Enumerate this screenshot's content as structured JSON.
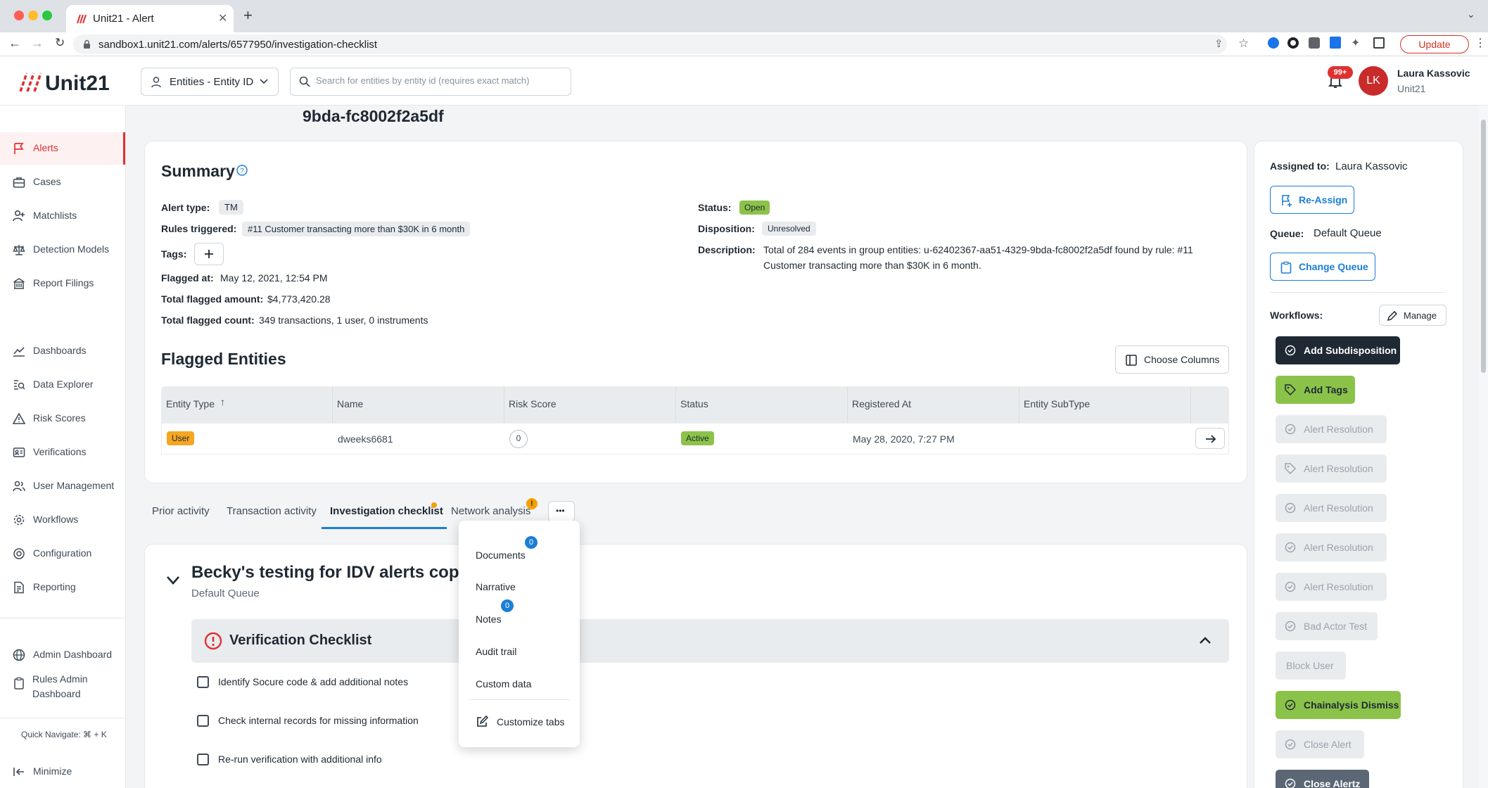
{
  "browser": {
    "tab_title": "Unit21 - Alert",
    "url": "sandbox1.unit21.com/alerts/6577950/investigation-checklist",
    "update_label": "Update"
  },
  "header": {
    "logo_text": "Unit21",
    "entity_select_label": "Entities - Entity ID",
    "search_placeholder": "Search for entities by entity id (requires exact match)",
    "notif_count": "99+",
    "avatar_initials": "LK",
    "user_name": "Laura Kassovic",
    "user_org": "Unit21"
  },
  "sidebar": {
    "items": [
      {
        "label": "Alerts",
        "icon": "flag-icon"
      },
      {
        "label": "Cases",
        "icon": "briefcase-icon"
      },
      {
        "label": "Matchlists",
        "icon": "user-plus-icon"
      },
      {
        "label": "Detection Models",
        "icon": "scale-icon"
      },
      {
        "label": "Report Filings",
        "icon": "building-icon"
      },
      {
        "label": "Dashboards",
        "icon": "chart-line-icon"
      },
      {
        "label": "Data Explorer",
        "icon": "search-data-icon"
      },
      {
        "label": "Risk Scores",
        "icon": "warning-icon"
      },
      {
        "label": "Verifications",
        "icon": "id-card-icon"
      },
      {
        "label": "User Management",
        "icon": "users-icon"
      },
      {
        "label": "Workflows",
        "icon": "gear-icon"
      },
      {
        "label": "Configuration",
        "icon": "settings-icon"
      },
      {
        "label": "Reporting",
        "icon": "report-icon"
      },
      {
        "label": "Admin Dashboard",
        "icon": "globe-icon"
      },
      {
        "label": "Rules Admin",
        "label2": "Dashboard",
        "icon": "clipboard-icon"
      }
    ],
    "quick_navigate": "Quick Navigate: ⌘ + K",
    "minimize": "Minimize"
  },
  "main": {
    "entity_title": "9bda-fc8002f2a5df",
    "summary": {
      "title": "Summary",
      "alert_type_label": "Alert type:",
      "alert_type": "TM",
      "rules_label": "Rules triggered:",
      "rules": "#11 Customer transacting more than $30K in 6 month",
      "tags_label": "Tags:",
      "flagged_at_label": "Flagged at:",
      "flagged_at": "May 12, 2021, 12:54 PM",
      "amount_label": "Total flagged amount:",
      "amount": "$4,773,420.28",
      "count_label": "Total flagged count:",
      "count": "349 transactions, 1 user, 0 instruments",
      "status_label": "Status:",
      "status": "Open",
      "disposition_label": "Disposition:",
      "disposition": "Unresolved",
      "description_label": "Description:",
      "description_line1": "Total of 284 events in group entities: u-62402367-aa51-4329-9bda-fc8002f2a5df found by rule: #11",
      "description_line2": "Customer transacting more than $30K in 6 month."
    },
    "flagged": {
      "title": "Flagged Entities",
      "choose_columns": "Choose Columns",
      "columns": [
        "Entity Type",
        "Name",
        "Risk Score",
        "Status",
        "Registered At",
        "Entity SubType"
      ],
      "row": {
        "entity_type": "User",
        "name": "dweeks6681",
        "risk_score": "0",
        "status": "Active",
        "registered_at": "May 28, 2020, 7:27 PM",
        "subtype": ""
      }
    },
    "tabs": [
      "Prior activity",
      "Transaction activity",
      "Investigation checklist",
      "Network analysis"
    ],
    "network_warn": "!",
    "more_label": "•••",
    "dropdown": {
      "items": [
        "Documents",
        "Narrative",
        "Notes",
        "Audit trail",
        "Custom data"
      ],
      "documents_count": "0",
      "notes_count": "0",
      "customize": "Customize tabs"
    },
    "checklist": {
      "title": "Becky's testing for IDV alerts copy",
      "queue": "Default Queue",
      "section_title": "Verification Checklist",
      "items": [
        "Identify Socure code & add additional notes",
        "Check internal records for missing information",
        "Re-run verification with additional info"
      ]
    }
  },
  "right_panel": {
    "assigned_label": "Assigned to:",
    "assigned_value": "Laura Kassovic",
    "reassign": "Re-Assign",
    "queue_label": "Queue:",
    "queue_value": "Default Queue",
    "change_queue": "Change Queue",
    "workflows_label": "Workflows:",
    "manage": "Manage",
    "workflows": [
      {
        "label": "Add Subdisposition",
        "style": "dark"
      },
      {
        "label": "Add Tags",
        "style": "green"
      },
      {
        "label": "Alert Resolution",
        "style": "grey"
      },
      {
        "label": "Alert Resolution",
        "style": "grey"
      },
      {
        "label": "Alert Resolution",
        "style": "grey"
      },
      {
        "label": "Alert Resolution",
        "style": "grey"
      },
      {
        "label": "Alert Resolution",
        "style": "grey"
      },
      {
        "label": "Bad Actor Test",
        "style": "grey"
      },
      {
        "label": "Block User",
        "style": "grey"
      },
      {
        "label": "Chainalysis Dismiss",
        "style": "green"
      },
      {
        "label": "Close Alert",
        "style": "grey"
      },
      {
        "label": "Close Alertz",
        "style": "slate"
      }
    ]
  },
  "colors": {
    "accent_red": "#e03131",
    "accent_blue": "#1c7ed6",
    "status_green": "#8bc34a",
    "user_orange": "#f5a623"
  }
}
